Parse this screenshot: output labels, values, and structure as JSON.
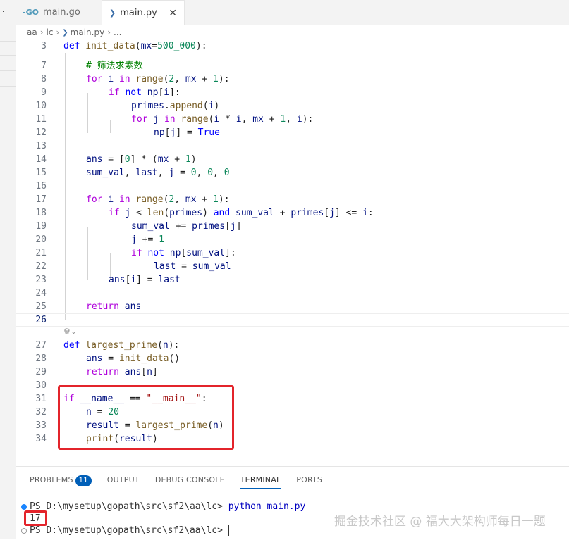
{
  "tabs": [
    {
      "label": "main.go",
      "icon": "go-file-icon",
      "active": false
    },
    {
      "label": "main.py",
      "icon": "python-file-icon",
      "active": true
    }
  ],
  "breadcrumb": {
    "segments": [
      "aa",
      "lc",
      "main.py",
      "..."
    ]
  },
  "code": {
    "line_numbers": [
      "3",
      "7",
      "8",
      "9",
      "10",
      "11",
      "12",
      "13",
      "14",
      "15",
      "16",
      "17",
      "18",
      "19",
      "20",
      "21",
      "22",
      "23",
      "24",
      "25",
      "26",
      "27",
      "28",
      "29",
      "30",
      "31",
      "32",
      "33",
      "34"
    ],
    "lines": {
      "l3": "def init_data(mx=500_000):",
      "l7": "    # 筛法求素数",
      "l8": "    for i in range(2, mx + 1):",
      "l9": "        if not np[i]:",
      "l10": "            primes.append(i)",
      "l11": "            for j in range(i * i, mx + 1, i):",
      "l12": "                np[j] = True",
      "l14": "    ans = [0] * (mx + 1)",
      "l15": "    sum_val, last, j = 0, 0, 0",
      "l17": "    for i in range(2, mx + 1):",
      "l18": "        if j < len(primes) and sum_val + primes[j] <= i:",
      "l19": "            sum_val += primes[j]",
      "l20": "            j += 1",
      "l21": "            if not np[sum_val]:",
      "l22": "                last = sum_val",
      "l23": "        ans[i] = last",
      "l25": "    return ans",
      "l27": "def largest_prime(n):",
      "l28": "    ans = init_data()",
      "l29": "    return ans[n]",
      "l31": "if __name__ == \"__main__\":",
      "l32": "    n = 20",
      "l33": "    result = largest_prime(n)",
      "l34": "    print(result)"
    },
    "codelens_icon": "copilot-icon"
  },
  "panel": {
    "tabs": [
      "PROBLEMS",
      "OUTPUT",
      "DEBUG CONSOLE",
      "TERMINAL",
      "PORTS"
    ],
    "problems_count": "11",
    "active_tab": "TERMINAL",
    "terminal": {
      "prompt1": "PS D:\\mysetup\\gopath\\src\\sf2\\aa\\lc> ",
      "command1": "python main.py",
      "output": "17",
      "prompt2": "PS D:\\mysetup\\gopath\\src\\sf2\\aa\\lc> "
    }
  },
  "watermark": "掘金技术社区 @ 福大大架构师每日一题",
  "colors": {
    "keyword": "#0000ff",
    "control": "#af00db",
    "function": "#795e26",
    "number": "#098658",
    "string": "#a31515",
    "comment": "#008000",
    "highlight_box": "#e3242b",
    "accent": "#005fb8"
  }
}
